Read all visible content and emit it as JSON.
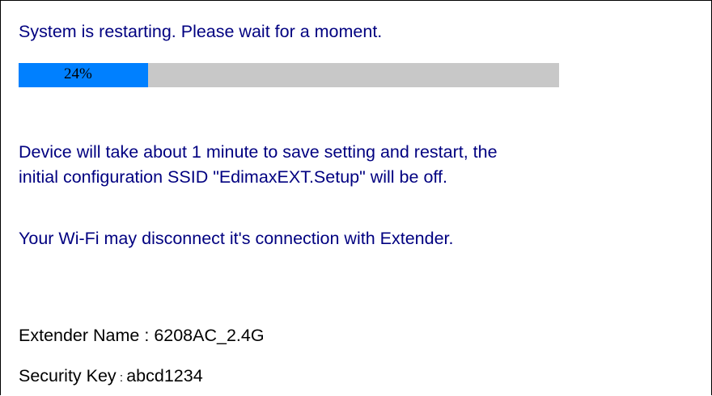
{
  "status": {
    "title": "System is restarting. Please wait for a moment.",
    "progress_percent": 24,
    "progress_label": "24%",
    "colors": {
      "text": "#000080",
      "progress_fill": "#0080ff",
      "progress_track": "#c8c8c8"
    }
  },
  "notice": {
    "line1": "Device will take about 1 minute to save setting and restart, the",
    "line2": "initial configuration SSID \"EdimaxEXT.Setup\" will be off.",
    "wifi": "Your Wi-Fi may disconnect it's connection with Extender."
  },
  "info": {
    "extender_name_label": "Extender Name",
    "extender_name_sep": " : ",
    "extender_name_value": "6208AC_2.4G",
    "security_key_label": "Security Key",
    "security_key_sep": " : ",
    "security_key_value": "abcd1234"
  }
}
